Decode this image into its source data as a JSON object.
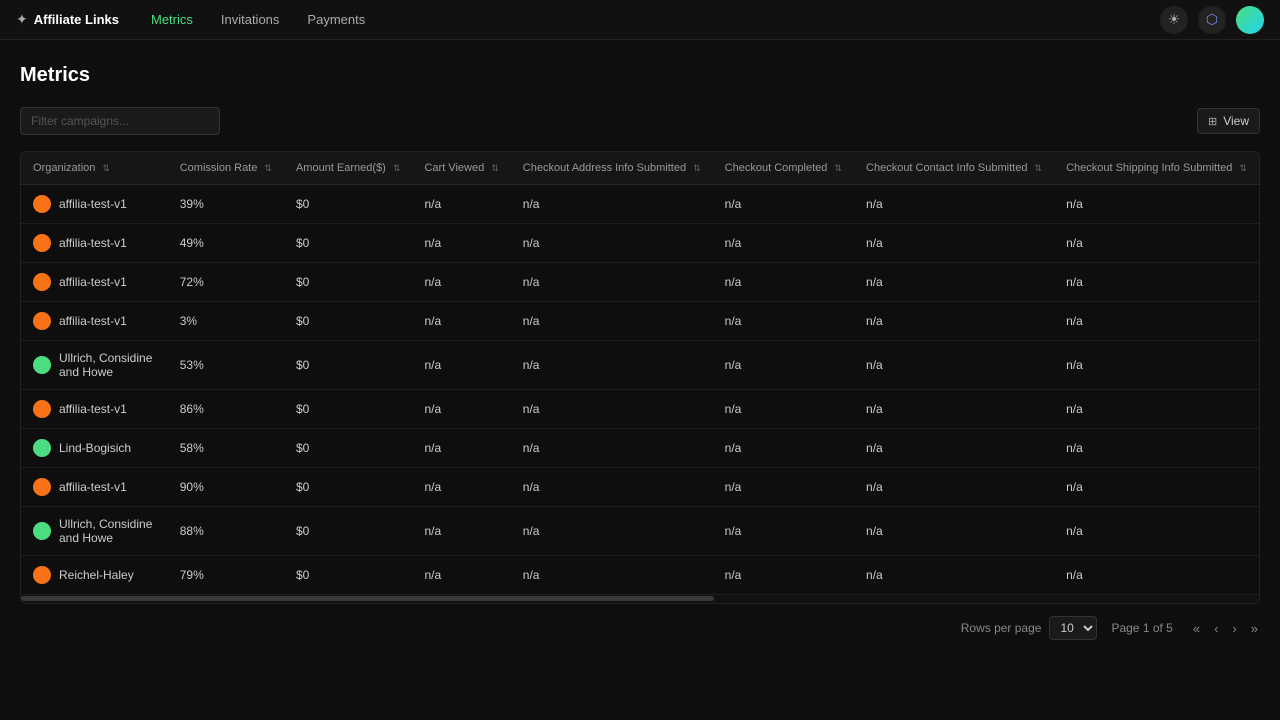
{
  "app": {
    "logo_icon": "✦",
    "logo_text": "Affiliate Links"
  },
  "nav": {
    "items": [
      {
        "label": "Metrics",
        "active": true
      },
      {
        "label": "Invitations",
        "active": false
      },
      {
        "label": "Payments",
        "active": false
      }
    ]
  },
  "header_icons": [
    {
      "name": "theme-icon",
      "symbol": "☀"
    },
    {
      "name": "discord-icon",
      "symbol": "⬡"
    }
  ],
  "page": {
    "title": "Metrics"
  },
  "toolbar": {
    "filter_placeholder": "Filter campaigns...",
    "view_label": "View"
  },
  "table": {
    "columns": [
      {
        "key": "organization",
        "label": "Organization"
      },
      {
        "key": "commission_rate",
        "label": "Comission Rate"
      },
      {
        "key": "amount_earned",
        "label": "Amount Earned($)"
      },
      {
        "key": "cart_viewed",
        "label": "Cart Viewed"
      },
      {
        "key": "checkout_address",
        "label": "Checkout Address Info Submitted"
      },
      {
        "key": "checkout_completed",
        "label": "Checkout Completed"
      },
      {
        "key": "checkout_contact",
        "label": "Checkout Contact Info Submitted"
      },
      {
        "key": "checkout_shipping",
        "label": "Checkout Shipping Info Submitted"
      }
    ],
    "rows": [
      {
        "org": "affilia-test-v1",
        "dot_color": "#f97316",
        "commission": "39%",
        "amount": "$0",
        "cart": "n/a",
        "addr": "n/a",
        "completed": "n/a",
        "contact": "n/a",
        "shipping": "n/a"
      },
      {
        "org": "affilia-test-v1",
        "dot_color": "#f97316",
        "commission": "49%",
        "amount": "$0",
        "cart": "n/a",
        "addr": "n/a",
        "completed": "n/a",
        "contact": "n/a",
        "shipping": "n/a"
      },
      {
        "org": "affilia-test-v1",
        "dot_color": "#f97316",
        "commission": "72%",
        "amount": "$0",
        "cart": "n/a",
        "addr": "n/a",
        "completed": "n/a",
        "contact": "n/a",
        "shipping": "n/a"
      },
      {
        "org": "affilia-test-v1",
        "dot_color": "#f97316",
        "commission": "3%",
        "amount": "$0",
        "cart": "n/a",
        "addr": "n/a",
        "completed": "n/a",
        "contact": "n/a",
        "shipping": "n/a"
      },
      {
        "org": "Ullrich, Considine and Howe",
        "dot_color": "#4ade80",
        "commission": "53%",
        "amount": "$0",
        "cart": "n/a",
        "addr": "n/a",
        "completed": "n/a",
        "contact": "n/a",
        "shipping": "n/a"
      },
      {
        "org": "affilia-test-v1",
        "dot_color": "#f97316",
        "commission": "86%",
        "amount": "$0",
        "cart": "n/a",
        "addr": "n/a",
        "completed": "n/a",
        "contact": "n/a",
        "shipping": "n/a"
      },
      {
        "org": "Lind-Bogisich",
        "dot_color": "#4ade80",
        "commission": "58%",
        "amount": "$0",
        "cart": "n/a",
        "addr": "n/a",
        "completed": "n/a",
        "contact": "n/a",
        "shipping": "n/a"
      },
      {
        "org": "affilia-test-v1",
        "dot_color": "#f97316",
        "commission": "90%",
        "amount": "$0",
        "cart": "n/a",
        "addr": "n/a",
        "completed": "n/a",
        "contact": "n/a",
        "shipping": "n/a"
      },
      {
        "org": "Ullrich, Considine and Howe",
        "dot_color": "#4ade80",
        "commission": "88%",
        "amount": "$0",
        "cart": "n/a",
        "addr": "n/a",
        "completed": "n/a",
        "contact": "n/a",
        "shipping": "n/a"
      },
      {
        "org": "Reichel-Haley",
        "dot_color": "#f97316",
        "commission": "79%",
        "amount": "$0",
        "cart": "n/a",
        "addr": "n/a",
        "completed": "n/a",
        "contact": "n/a",
        "shipping": "n/a"
      }
    ]
  },
  "pagination": {
    "rows_per_page_label": "Rows per page",
    "rows_per_page_value": "10",
    "page_info": "Page 1 of 5",
    "btn_first": "«",
    "btn_prev": "‹",
    "btn_next": "›",
    "btn_last": "»"
  }
}
